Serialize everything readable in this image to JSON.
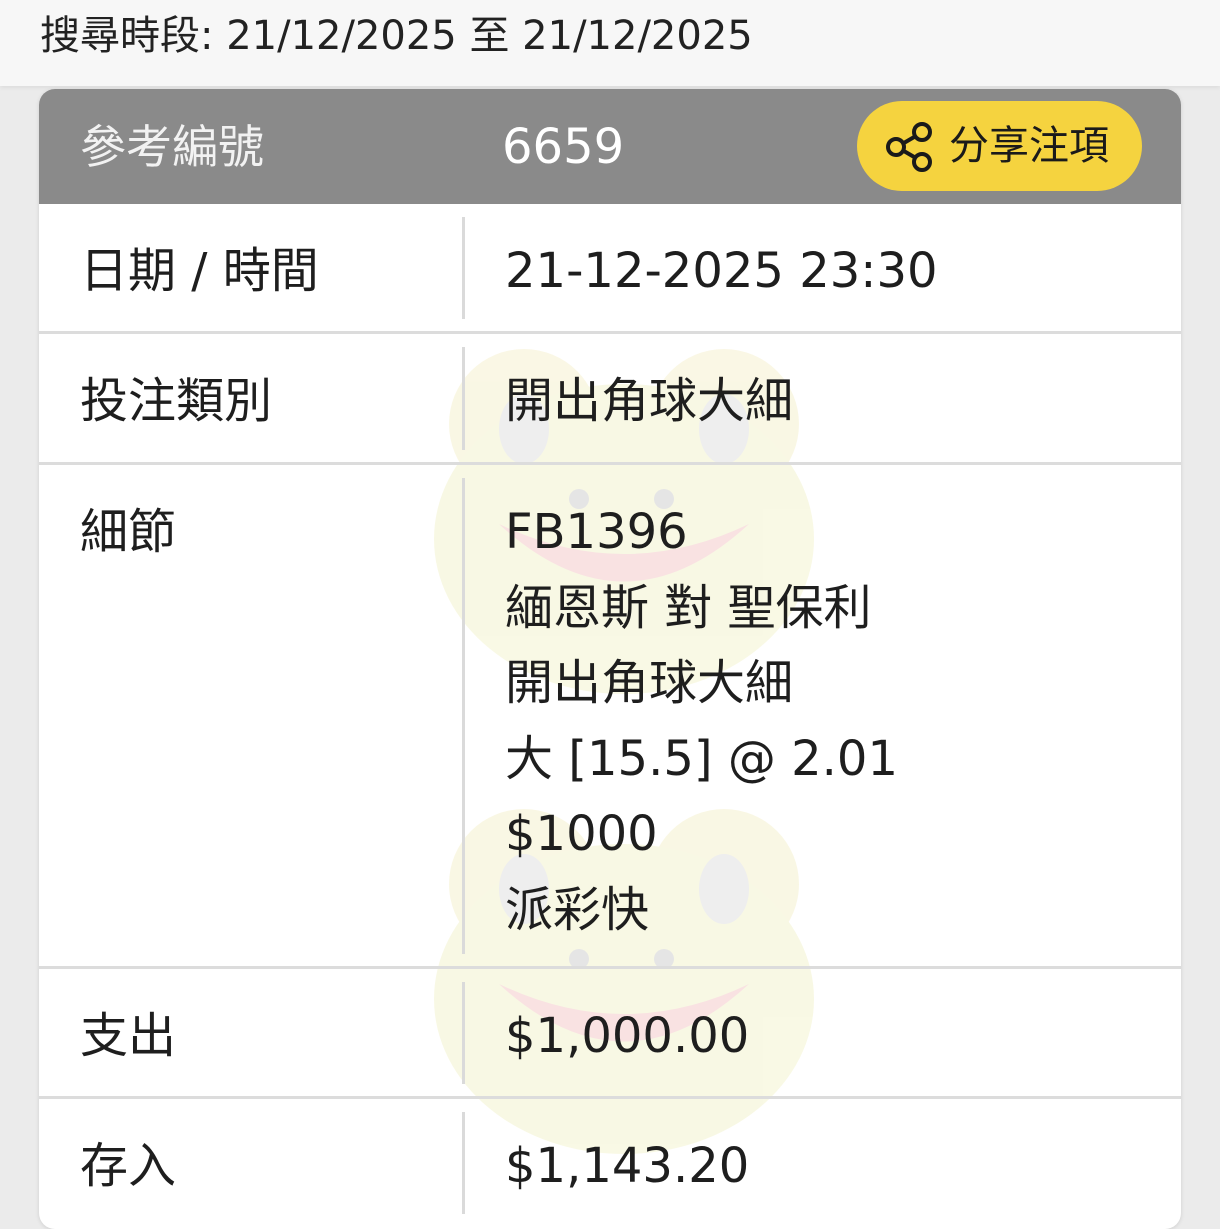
{
  "search": {
    "period_text": "搜尋時段: 21/12/2025 至 21/12/2025"
  },
  "header": {
    "reference_label": "參考編號",
    "reference_number": "6659",
    "share_button_label": "分享注項",
    "share_icon": "share-icon"
  },
  "rows": {
    "datetime": {
      "label": "日期 / 時間",
      "value": "21-12-2025 23:30"
    },
    "bet_type": {
      "label": "投注類別",
      "value": "開出角球大細"
    },
    "details": {
      "label": "細節",
      "lines": [
        "FB1396",
        "緬恩斯 對 聖保利",
        "開出角球大細",
        "大 [15.5] @ 2.01",
        "$1000",
        "派彩快"
      ]
    },
    "expense": {
      "label": "支出",
      "value": "$1,000.00"
    },
    "deposit": {
      "label": "存入",
      "value": "$1,143.20"
    }
  },
  "colors": {
    "header_bg": "#8a8a8a",
    "share_button_bg": "#f5d33f",
    "page_bg": "#ebebeb",
    "card_bg": "#ffffff",
    "divider": "#dcdcdc"
  }
}
